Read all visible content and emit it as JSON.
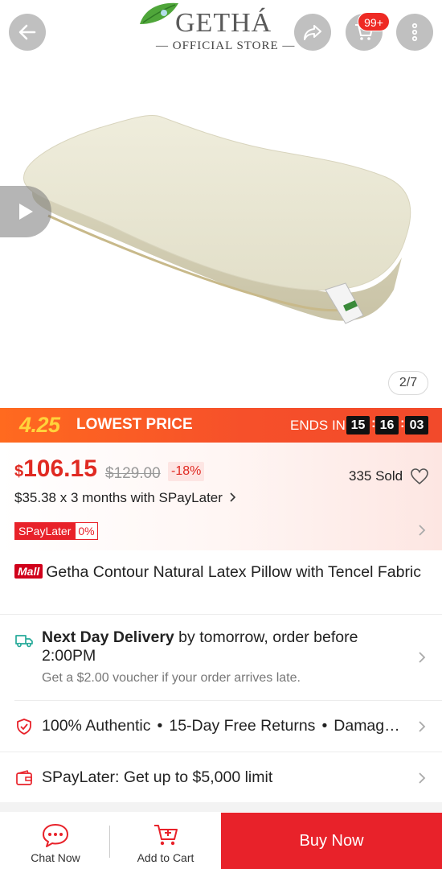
{
  "header": {
    "brand_name": "GETHÁ",
    "brand_subtitle": "— OFFICIAL STORE —",
    "cart_badge": "99+",
    "icons": [
      "back-arrow-icon",
      "share-icon",
      "cart-icon",
      "more-vertical-icon"
    ]
  },
  "gallery": {
    "pager": "2/7",
    "video_icon": "play-icon"
  },
  "flash_sale": {
    "date_label": "4.25",
    "title": "LOWEST PRICE",
    "ends_label": "ENDS IN",
    "hours": "15",
    "minutes": "16",
    "seconds": "03"
  },
  "pricing": {
    "currency": "$",
    "price": "106.15",
    "original_price": "$129.00",
    "discount": "-18%",
    "sold": "335 Sold",
    "installment": "$35.38 x 3 months with SPayLater",
    "spaylater_badge": "SPayLater",
    "spaylater_rate": "0%"
  },
  "product": {
    "mall_tag": "Mall",
    "title": "Getha Contour Natural Latex Pillow with Tencel Fabric"
  },
  "delivery": {
    "bold": "Next Day Delivery",
    "rest": " by tomorrow, order before 2:00PM",
    "note": "Get a $2.00 voucher if your order arrives late."
  },
  "guarantee": {
    "items": [
      "100% Authentic",
      "15-Day Free Returns",
      "Damag…"
    ],
    "separator": "•"
  },
  "spaylater_promo": "SPayLater: Get up to $5,000 limit",
  "bottom_bar": {
    "chat_label": "Chat Now",
    "cart_label": "Add to Cart",
    "buy_label": "Buy Now"
  },
  "colors": {
    "accent_red": "#e8222a",
    "price_red": "#e02a22",
    "flash_orange": "#f6502a",
    "flash_yellow": "#ffd33b"
  }
}
